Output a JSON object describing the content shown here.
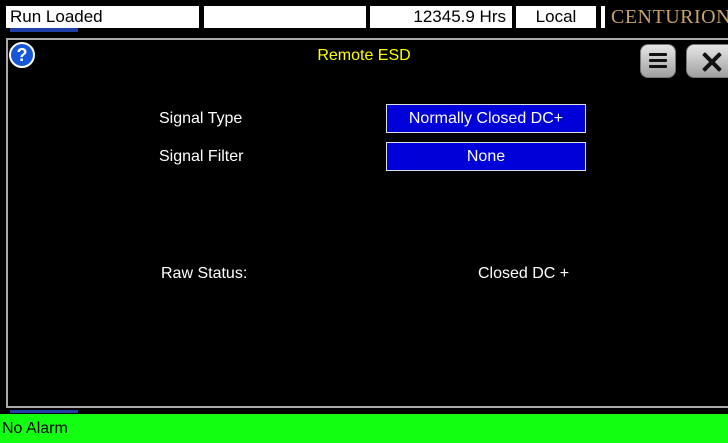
{
  "statusbar": {
    "run_status": "Run Loaded",
    "blank": "",
    "hours": "12345.9 Hrs",
    "mode": "Local",
    "brand": "CENTURION"
  },
  "dialog": {
    "title": "Remote ESD",
    "help_glyph": "?",
    "fields": [
      {
        "label": "Signal Type",
        "value": "Normally Closed DC+"
      },
      {
        "label": "Signal Filter",
        "value": "None"
      }
    ],
    "raw_status": {
      "label": "Raw Status:",
      "value": "Closed DC +"
    }
  },
  "alarm_bar": {
    "text": "No Alarm"
  },
  "colors": {
    "title": "#ffff00",
    "field_bg": "#0000d8",
    "alarm_bg": "#12ff12",
    "help_bg": "#1557d6",
    "brand": "#c8a26a"
  },
  "icons": {
    "help": "help-question-icon",
    "menu": "menu-icon",
    "close": "close-icon"
  }
}
